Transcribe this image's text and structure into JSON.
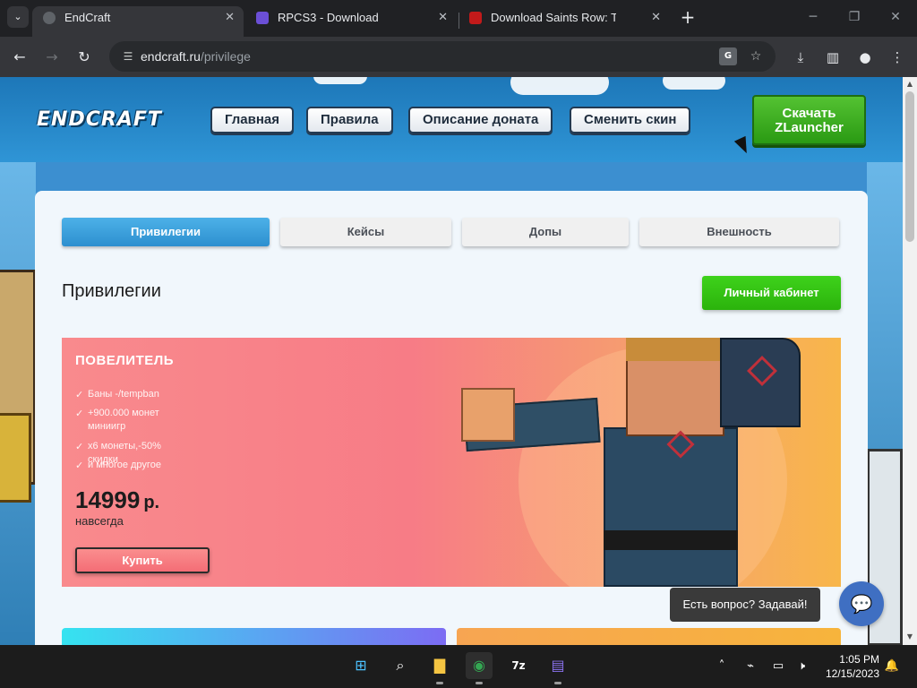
{
  "browser": {
    "tabs": [
      {
        "title": "EndCraft",
        "active": true,
        "favicon_color": "#5f6368"
      },
      {
        "title": "RPCS3 - Download",
        "active": false,
        "favicon_color": "#6b4fd6"
      },
      {
        "title": "Download Saints Row: The Third",
        "active": false,
        "favicon_color": "#c21a1a"
      }
    ],
    "url": {
      "domain": "endcraft.ru",
      "path": "/privilege"
    }
  },
  "site": {
    "logo": "ENDCRAFT",
    "nav": [
      "Главная",
      "Правила",
      "Описание доната",
      "Сменить скин"
    ],
    "download_button": {
      "line1": "Скачать",
      "line2": "ZLauncher"
    },
    "category_tabs": [
      {
        "label": "Привилегии",
        "active": true
      },
      {
        "label": "Кейсы",
        "active": false
      },
      {
        "label": "Допы",
        "active": false
      },
      {
        "label": "Внешность",
        "active": false
      }
    ],
    "section_title": "Привилегии",
    "cabinet_button": "Личный кабинет",
    "privilege": {
      "name": "ПОВЕЛИТЕЛЬ",
      "features": [
        {
          "text": "Баны -/tempban"
        },
        {
          "text": "+900.000 монет миниигр"
        },
        {
          "text": "x6 монеты,-50% скидки"
        },
        {
          "text": "и многое другое"
        }
      ],
      "price": "14999",
      "currency": "р.",
      "period": "навсегда",
      "buy_button": "Купить"
    },
    "chat": {
      "prompt": "Есть вопрос? Задавай!"
    }
  },
  "taskbar": {
    "time": "1:05 PM",
    "date": "12/15/2023"
  }
}
